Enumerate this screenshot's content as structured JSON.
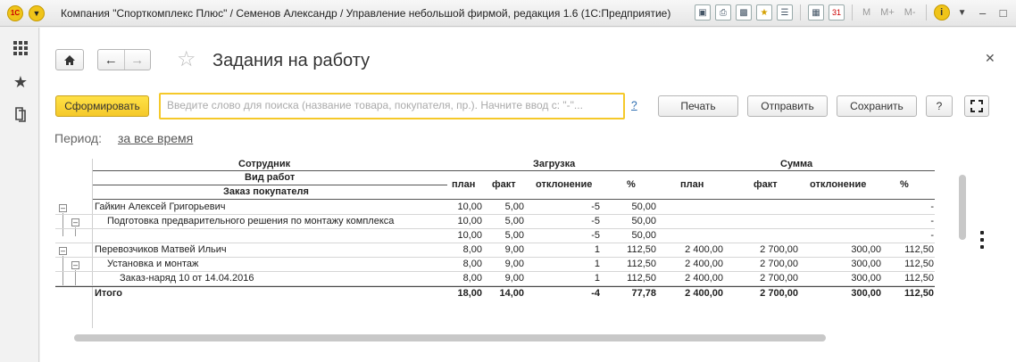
{
  "window": {
    "title": "Компания \"Спорткомплекс Плюс\" / Семенов Александр / Управление небольшой фирмой, редакция 1.6  (1С:Предприятие)",
    "logo_text": "1С",
    "calc_m": "M",
    "calc_mplus": "M+",
    "calc_mminus": "M-",
    "calendar_day": "31"
  },
  "page": {
    "title": "Задания на работу"
  },
  "toolbar": {
    "generate_label": "Сформировать",
    "search_placeholder": "Введите слово для поиска (название товара, покупателя, пр.). Начните ввод с: \"-\"...",
    "help_link": "?",
    "print_label": "Печать",
    "send_label": "Отправить",
    "save_label": "Сохранить",
    "help_label": "?"
  },
  "period": {
    "label": "Период:",
    "value": "за все время"
  },
  "report": {
    "headers": {
      "employee": "Сотрудник",
      "work_type": "Вид работ",
      "customer_order": "Заказ покупателя",
      "load": "Загрузка",
      "sum": "Сумма",
      "plan": "план",
      "fact": "факт",
      "deviation": "отклонение",
      "percent": "%"
    },
    "rows": [
      {
        "name": "Гайкин Алексей Григорьевич",
        "load_plan": "10,00",
        "load_fact": "5,00",
        "load_dev": "-5",
        "load_pct": "50,00",
        "sum_plan": "",
        "sum_fact": "",
        "sum_dev": "",
        "sum_pct": "-"
      },
      {
        "name": "Подготовка предварительного решения по монтажу комплекса",
        "load_plan": "10,00",
        "load_fact": "5,00",
        "load_dev": "-5",
        "load_pct": "50,00",
        "sum_plan": "",
        "sum_fact": "",
        "sum_dev": "",
        "sum_pct": "-"
      },
      {
        "name": "",
        "load_plan": "10,00",
        "load_fact": "5,00",
        "load_dev": "-5",
        "load_pct": "50,00",
        "sum_plan": "",
        "sum_fact": "",
        "sum_dev": "",
        "sum_pct": "-"
      },
      {
        "name": "Перевозчиков Матвей Ильич",
        "load_plan": "8,00",
        "load_fact": "9,00",
        "load_dev": "1",
        "load_pct": "112,50",
        "sum_plan": "2 400,00",
        "sum_fact": "2 700,00",
        "sum_dev": "300,00",
        "sum_pct": "112,50"
      },
      {
        "name": "Установка и монтаж",
        "load_plan": "8,00",
        "load_fact": "9,00",
        "load_dev": "1",
        "load_pct": "112,50",
        "sum_plan": "2 400,00",
        "sum_fact": "2 700,00",
        "sum_dev": "300,00",
        "sum_pct": "112,50"
      },
      {
        "name": "Заказ-наряд 10 от 14.04.2016",
        "load_plan": "8,00",
        "load_fact": "9,00",
        "load_dev": "1",
        "load_pct": "112,50",
        "sum_plan": "2 400,00",
        "sum_fact": "2 700,00",
        "sum_dev": "300,00",
        "sum_pct": "112,50"
      }
    ],
    "total": {
      "name": "Итого",
      "load_plan": "18,00",
      "load_fact": "14,00",
      "load_dev": "-4",
      "load_pct": "77,78",
      "sum_plan": "2 400,00",
      "sum_fact": "2 700,00",
      "sum_dev": "300,00",
      "sum_pct": "112,50"
    }
  }
}
